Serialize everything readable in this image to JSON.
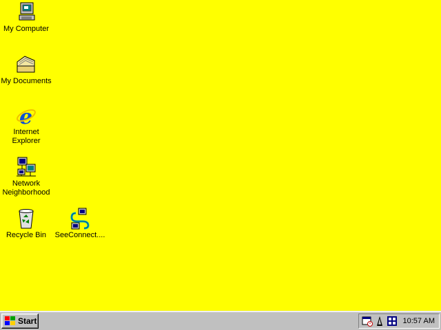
{
  "desktop": {
    "background_color": "#ffff00",
    "icons": [
      {
        "label": "My Computer",
        "icon": "my-computer-icon"
      },
      {
        "label": "My Documents",
        "icon": "my-documents-icon"
      },
      {
        "label": "Internet\nExplorer",
        "icon": "internet-explorer-icon"
      },
      {
        "label": "Network\nNeighborhood",
        "icon": "network-neighborhood-icon"
      },
      {
        "label": "Recycle Bin",
        "icon": "recycle-bin-icon"
      },
      {
        "label": "SeeConnect....",
        "icon": "seeconnect-icon"
      }
    ]
  },
  "taskbar": {
    "start_label": "Start",
    "tray_icons": [
      "scheduler-icon",
      "network-tower-icon",
      "network-adapter-icon"
    ],
    "clock": "10:57 AM"
  }
}
